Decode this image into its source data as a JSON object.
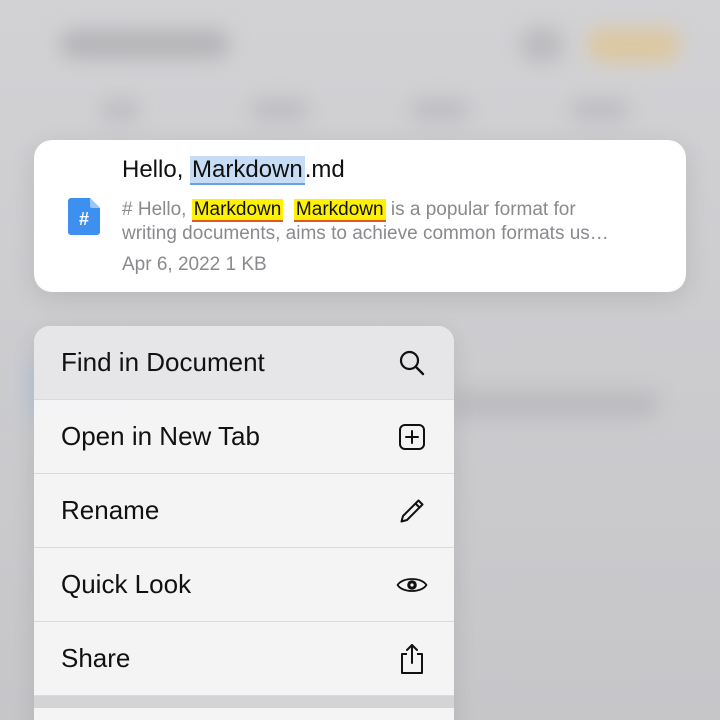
{
  "preview_card": {
    "title_prefix": "Hello, ",
    "title_highlight": "Markdown",
    "title_suffix": ".md",
    "file_icon_glyph": "#",
    "snippet_line1_prefix": "# Hello, ",
    "snippet_match1": "Markdown",
    "snippet_match2": "Markdown",
    "snippet_line1_suffix": " is a popular format for",
    "snippet_line2": "writing documents, aims to achieve common formats us…",
    "date": "Apr 6, 2022",
    "size": "1 KB"
  },
  "context_menu": {
    "items": [
      {
        "label": "Find in Document",
        "icon": "search-icon"
      },
      {
        "label": "Open in New Tab",
        "icon": "plus-square-icon"
      },
      {
        "label": "Rename",
        "icon": "pencil-icon"
      },
      {
        "label": "Quick Look",
        "icon": "eye-icon"
      },
      {
        "label": "Share",
        "icon": "share-icon"
      }
    ]
  },
  "colors": {
    "highlight_yellow": "#fff200",
    "title_highlight_blue": "#c7dcf5",
    "file_icon_blue": "#3d8ff0",
    "secondary_text": "#8a8a8e"
  }
}
